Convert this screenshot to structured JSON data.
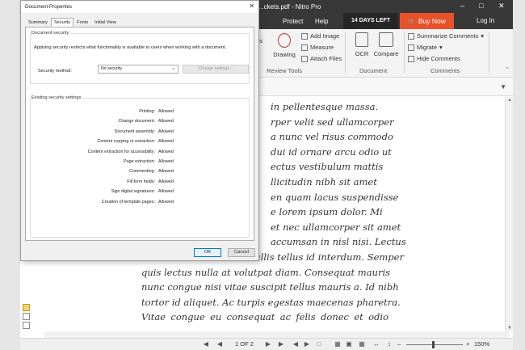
{
  "app": {
    "window_title": "...ckets.pdf - Nitro Pro",
    "tabs": {
      "protect": "Protect",
      "help": "Help"
    },
    "trial_badge": "14 DAYS LEFT",
    "buy_now": "Buy Now",
    "login": "Log In",
    "ribbon": {
      "draw_label": "Drawing",
      "notes_label": "es",
      "add_image": "Add Image",
      "measure": "Measure",
      "attach_files": "Attach Files",
      "ocr": "OCR",
      "compare": "Compare",
      "summarize_comments": "Summarize Comments",
      "migrate": "Migrate",
      "hide_comments": "Hide Comments",
      "group_review_tools": "Review Tools",
      "group_document": "Document",
      "group_comments": "Comments"
    },
    "document_lines": [
      "in pellentesque massa.",
      "rper velit sed ullamcorper",
      "a nunc vel risus commodo",
      "dui id ornare arcu odio ut",
      "ectus vestibulum mattis",
      "llicitudin nibh sit amet",
      "en quam lacus suspendisse",
      "e lorem ipsum dolor. Mi",
      "et nec ullamcorper sit amet",
      "accumsan in nisl nisi. Lectus",
      "urna duis convallis convallis tellus id interdum. Semper",
      "quis lectus nulla at volutpat diam. Consequat mauris",
      "nunc congue nisi vitae suscipit tellus mauris a. Id nibh",
      "tortor id aliquet. Ac turpis egestas maecenas pharetra.",
      "Vitae congue eu consequat ac felis donec et odio"
    ],
    "status": {
      "page": "1 OF 2",
      "zoom": "150%"
    }
  },
  "dialog": {
    "title": "Document Properties",
    "tabs": [
      "Summary",
      "Security",
      "Fonts",
      "Initial View"
    ],
    "active_tab": "Security",
    "security_group": {
      "legend": "Document security",
      "description": "Applying security restricts what functionality is available to users when working with a document.",
      "method_label": "Security method:",
      "method_value": "No security",
      "change_settings": "Change settings..."
    },
    "existing_group": {
      "legend": "Existing security settings",
      "rows": [
        {
          "label": "Printing:",
          "value": "Allowed"
        },
        {
          "label": "Change document:",
          "value": "Allowed"
        },
        {
          "label": "Document assembly:",
          "value": "Allowed"
        },
        {
          "label": "Content copying or extraction:",
          "value": "Allowed"
        },
        {
          "label": "Content extraction for accessibility:",
          "value": "Allowed"
        },
        {
          "label": "Page extraction:",
          "value": "Allowed"
        },
        {
          "label": "Commenting:",
          "value": "Allowed"
        },
        {
          "label": "Fill form fields:",
          "value": "Allowed"
        },
        {
          "label": "Sign digital signatures:",
          "value": "Allowed"
        },
        {
          "label": "Creation of template pages:",
          "value": "Allowed"
        }
      ]
    },
    "ok": "OK",
    "cancel": "Cancel"
  },
  "colors": {
    "titlebar": "#383838",
    "buy_now": "#e8512a",
    "dialog_bg": "#f0f0f0"
  }
}
